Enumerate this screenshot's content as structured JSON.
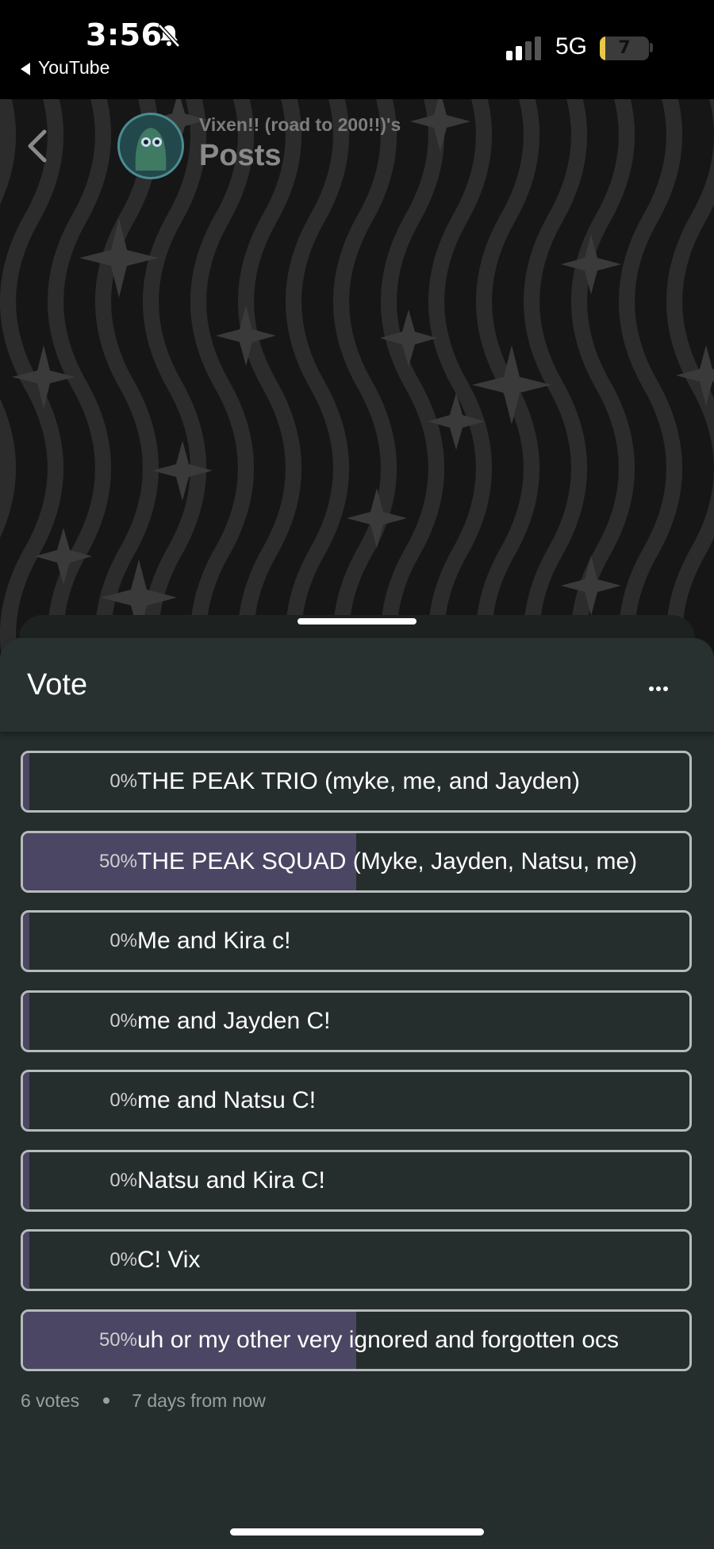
{
  "status_bar": {
    "time": "3:56",
    "back_app": "YouTube",
    "network": "5G",
    "battery": "7",
    "battery_level": 0.07
  },
  "header": {
    "owner": "Vixen!! (road to 200!!)'s",
    "title": "Posts"
  },
  "poll": {
    "title": "Vote",
    "options": [
      {
        "percent": "0%",
        "label": "THE PEAK TRIO (myke, me, and Jayden)",
        "share": 0
      },
      {
        "percent": "50%",
        "label": "THE PEAK SQUAD (Myke, Jayden, Natsu, me)",
        "share": 0.5
      },
      {
        "percent": "0%",
        "label": "Me and Kira c!",
        "share": 0
      },
      {
        "percent": "0%",
        "label": "me and Jayden C!",
        "share": 0
      },
      {
        "percent": "0%",
        "label": "me and Natsu C!",
        "share": 0
      },
      {
        "percent": "0%",
        "label": "Natsu and Kira C!",
        "share": 0
      },
      {
        "percent": "0%",
        "label": "C! Vix",
        "share": 0
      },
      {
        "percent": "50%",
        "label": "uh or my other very ignored and forgotten ocs",
        "share": 0.5
      }
    ],
    "votes": "6 votes",
    "time_left": "7 days from now"
  },
  "colors": {
    "sheet_bg": "#262d2d",
    "bar_fill": "#4a4663",
    "option_border": "#b8bbbb"
  }
}
